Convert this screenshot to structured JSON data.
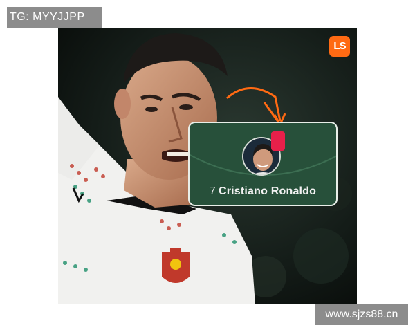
{
  "watermarks": {
    "top": "TG: MYYJJPP",
    "bottom": "www.sjzs88.cn"
  },
  "logo": {
    "text": "LS",
    "color": "#ff6a13"
  },
  "player_card": {
    "number": "7",
    "name": "Cristiano Ronaldo",
    "card_color": "#e8204a",
    "background": "#27503a"
  },
  "icons": [
    "arrow-icon",
    "red-card-icon",
    "portugal-crest-icon",
    "puma-logo-icon"
  ]
}
